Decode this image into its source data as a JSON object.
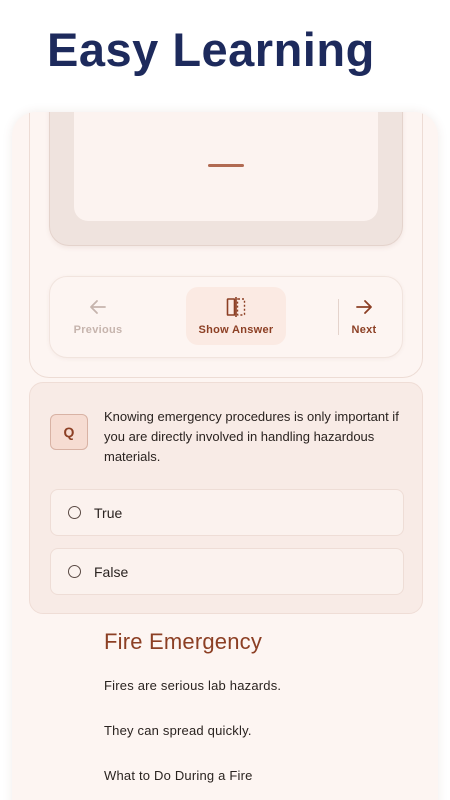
{
  "headline": "Easy Learning",
  "controls": {
    "previous_label": "Previous",
    "show_answer_label": "Show Answer",
    "next_label": "Next"
  },
  "quiz": {
    "badge": "Q",
    "question": "Knowing emergency procedures is only important if you are directly involved in handling hazardous materials.",
    "options": [
      "True",
      "False"
    ]
  },
  "section": {
    "title": "Fire Emergency",
    "paragraphs": [
      "Fires are serious lab hazards.",
      "They can spread quickly.",
      "What to Do During a Fire"
    ]
  },
  "colors": {
    "headline": "#1d2a5c",
    "accent": "#8c3f24",
    "background": "#fdf5f2"
  },
  "icons": {
    "previous": "arrow-left-icon",
    "show_answer": "flip-card-icon",
    "next": "arrow-right-icon"
  }
}
